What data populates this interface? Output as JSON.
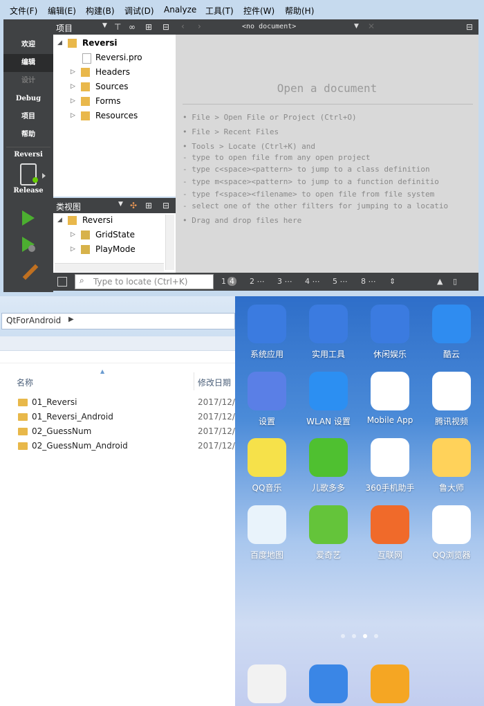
{
  "menu": [
    "文件(F)",
    "编辑(E)",
    "构建(B)",
    "调试(D)",
    "Analyze",
    "工具(T)",
    "控件(W)",
    "帮助(H)"
  ],
  "modes": [
    "欢迎",
    "编辑",
    "设计",
    "Debug",
    "项目",
    "帮助"
  ],
  "kit": {
    "project": "Reversi",
    "config": "Release"
  },
  "project_pane": {
    "title": "项目",
    "tree": [
      "Reversi",
      "Reversi.pro",
      "Headers",
      "Sources",
      "Forms",
      "Resources"
    ]
  },
  "class_pane": {
    "title": "类视图",
    "tree": [
      "Reversi",
      "GridState",
      "PlayMode"
    ]
  },
  "editor": {
    "doc_selector": "<no document>",
    "heading": "Open a document",
    "lines": [
      "• File > Open File or Project (Ctrl+O)",
      "• File > Recent Files",
      "• Tools > Locate (Ctrl+K) and",
      "  - type to open file from any open project",
      "  - type c<space><pattern> to jump to a class definition",
      "  - type m<space><pattern> to jump to a function definitio",
      "  - type f<space><filename> to open file from file system",
      "  - select one of the other filters for jumping to a locatio",
      "• Drag and drop files here"
    ]
  },
  "statusbar": {
    "locate_placeholder": "Type to locate (Ctrl+K)",
    "panes": [
      "1",
      "4",
      "2",
      "3",
      "4",
      "5",
      "8"
    ]
  },
  "explorer": {
    "breadcrumb": "QtForAndroid",
    "columns": [
      "名称",
      "修改日期"
    ],
    "rows": [
      {
        "name": "01_Reversi",
        "date": "2017/12/"
      },
      {
        "name": "01_Reversi_Android",
        "date": "2017/12/"
      },
      {
        "name": "02_GuessNum",
        "date": "2017/12/"
      },
      {
        "name": "02_GuessNum_Android",
        "date": "2017/12/"
      }
    ]
  },
  "phone": {
    "apps": [
      {
        "label": "系统应用",
        "icon": "folder-icon",
        "color": "#3b7be0"
      },
      {
        "label": "实用工具",
        "icon": "folder-icon",
        "color": "#3b7be0"
      },
      {
        "label": "休闲娱乐",
        "icon": "folder-icon",
        "color": "#3b7be0"
      },
      {
        "label": "酷云",
        "icon": "cloud-icon",
        "color": "#2f8cf0"
      },
      {
        "label": "设置",
        "icon": "gear-icon",
        "color": "#5a7fe6"
      },
      {
        "label": "WLAN 设置",
        "icon": "wifi-icon",
        "color": "#2c8ff2"
      },
      {
        "label": "Mobile App",
        "icon": "nissan-icon",
        "color": "#ffffff"
      },
      {
        "label": "腾讯视频",
        "icon": "play-icon",
        "color": "#ffffff"
      },
      {
        "label": "QQ音乐",
        "icon": "music-icon",
        "color": "#f6e14a"
      },
      {
        "label": "儿歌多多",
        "icon": "kids-icon",
        "color": "#4fc030"
      },
      {
        "label": "360手机助手",
        "icon": "360-icon",
        "color": "#ffffff"
      },
      {
        "label": "鲁大师",
        "icon": "ludashi-icon",
        "color": "#ffd25a"
      },
      {
        "label": "百度地图",
        "icon": "map-icon",
        "color": "#e9f3fb"
      },
      {
        "label": "爱奇艺",
        "icon": "iqiyi-icon",
        "color": "#64c43a"
      },
      {
        "label": "互联网",
        "icon": "browser-icon",
        "color": "#f06a2a"
      },
      {
        "label": "QQ浏览器",
        "icon": "qqbrowser-icon",
        "color": "#ffffff"
      }
    ],
    "dock": [
      {
        "icon": "clock-icon"
      },
      {
        "icon": "contacts-icon"
      },
      {
        "icon": "messages-icon"
      }
    ]
  }
}
